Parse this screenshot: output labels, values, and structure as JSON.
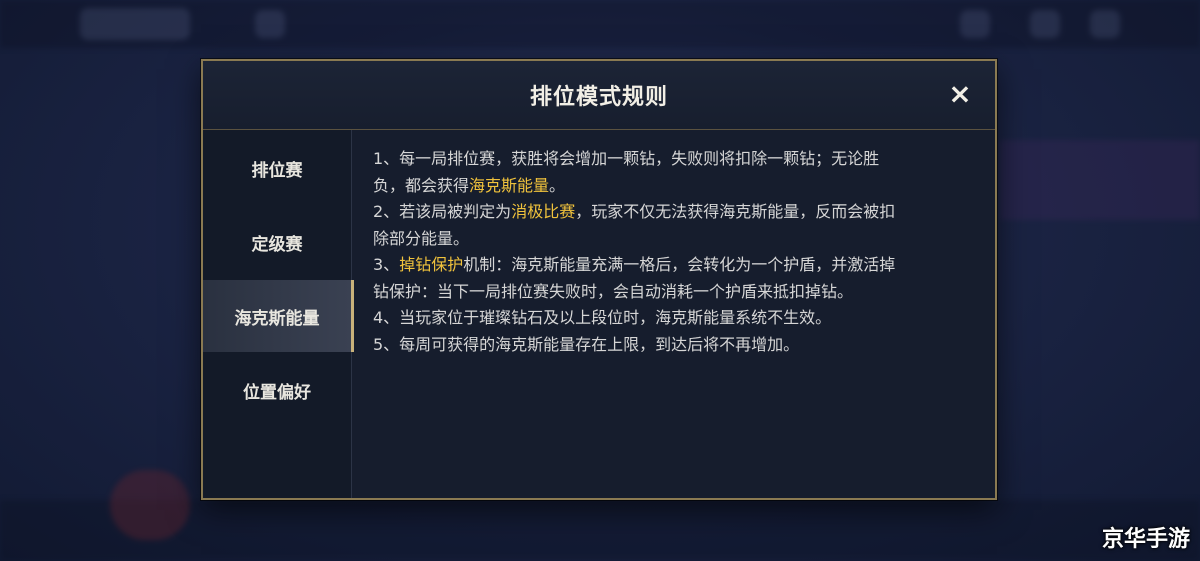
{
  "modal": {
    "title": "排位模式规则",
    "close_label": "×"
  },
  "sidebar": {
    "tabs": [
      {
        "label": "排位赛",
        "active": false
      },
      {
        "label": "定级赛",
        "active": false
      },
      {
        "label": "海克斯能量",
        "active": true
      },
      {
        "label": "位置偏好",
        "active": false
      }
    ]
  },
  "rules": {
    "r1_a": "1、每一局排位赛，获胜将会增加一颗钻，失败则将扣除一颗钻；无论胜",
    "r1_b": "负，都会获得",
    "r1_hl": "海克斯能量",
    "r1_c": "。",
    "r2_a": "2、若该局被判定为",
    "r2_hl": "消极比赛",
    "r2_b": "，玩家不仅无法获得海克斯能量，反而会被扣",
    "r2_c": "除部分能量。",
    "r3_a": "3、",
    "r3_hl": "掉钻保护",
    "r3_b": "机制：海克斯能量充满一格后，会转化为一个护盾，并激活掉",
    "r3_c": "钻保护：当下一局排位赛失败时，会自动消耗一个护盾来抵扣掉钻。",
    "r4": "4、当玩家位于璀璨钻石及以上段位时，海克斯能量系统不生效。",
    "r5": "5、每周可获得的海克斯能量存在上限，到达后将不再增加。"
  },
  "watermark": "京华手游",
  "colors": {
    "highlight": "#f0c23c",
    "border_gold": "#8a7a52",
    "active_indicator": "#c9b27a"
  }
}
